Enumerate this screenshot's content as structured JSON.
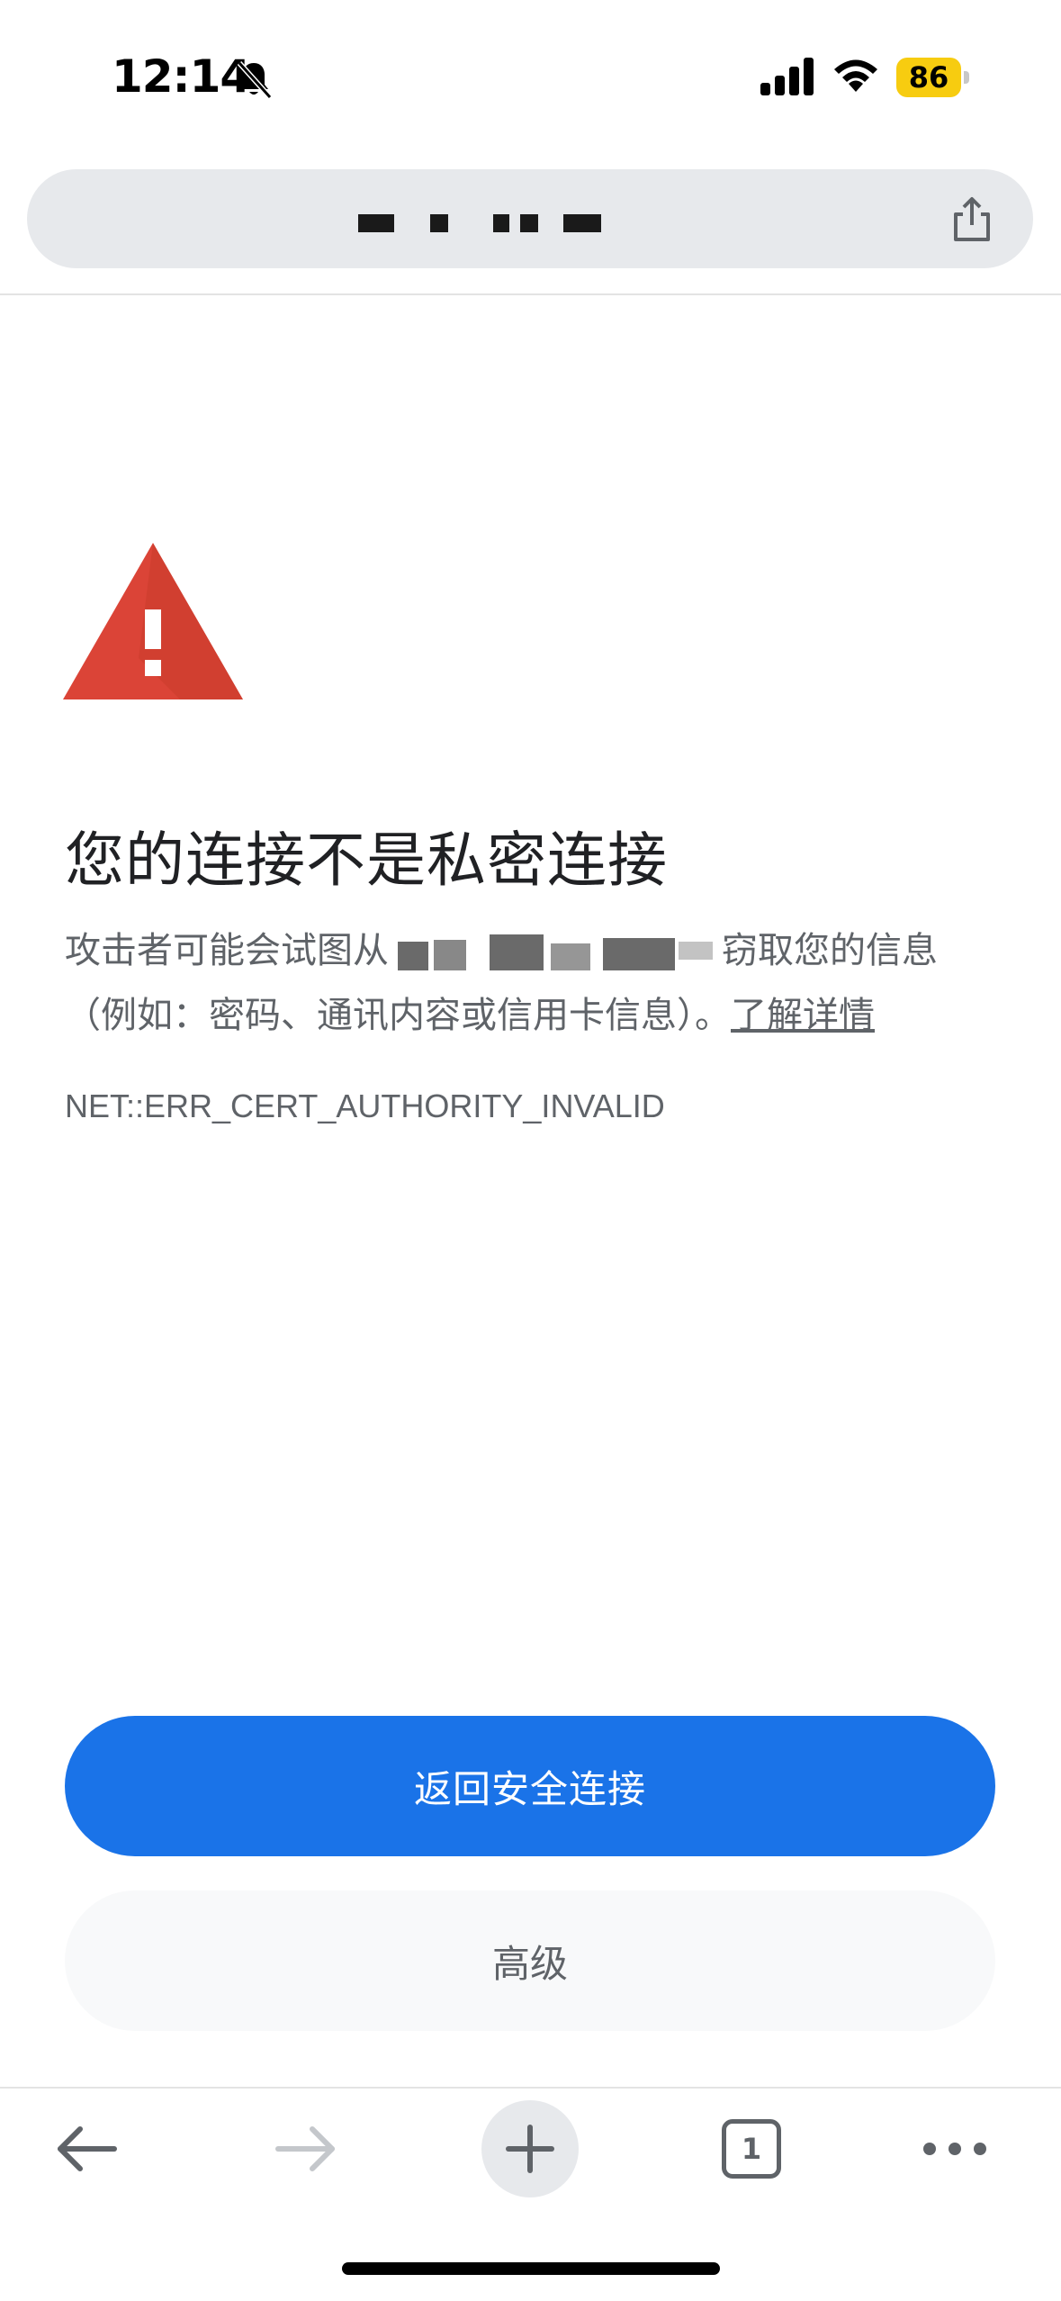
{
  "status_bar": {
    "time": "12:14",
    "battery_level": "86",
    "icons": [
      "bell-slash-icon",
      "cellular-signal-icon",
      "wifi-icon",
      "battery-icon"
    ]
  },
  "url_bar": {
    "icons": [
      "share-icon"
    ]
  },
  "content": {
    "title": "您的连接不是私密连接",
    "body_prefix": "攻击者可能会试图从",
    "body_suffix": "窃取您的信息（例如：密码、通讯内容或信用卡信息）。",
    "learn_more": "了解详情",
    "error_code": "NET::ERR_CERT_AUTHORITY_INVALID",
    "warning_color": "#db4437"
  },
  "buttons": {
    "back_to_safety": "返回安全连接",
    "advanced": "高级",
    "primary_color": "#1a73e8"
  },
  "toolbar": {
    "tab_count": "1",
    "icons": [
      "back-arrow-icon",
      "forward-arrow-icon",
      "plus-icon",
      "tab-switcher-icon",
      "more-icon"
    ]
  }
}
